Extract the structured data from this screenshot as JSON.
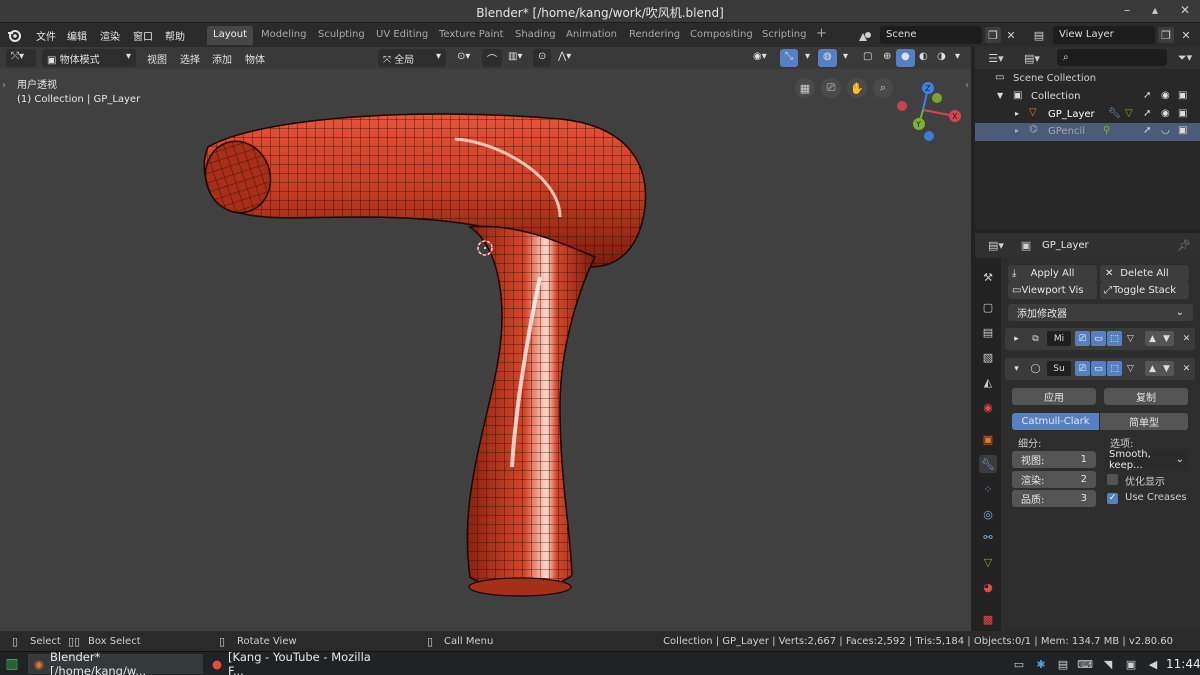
{
  "window": {
    "title": "Blender* [/home/kang/work/吹风机.blend]",
    "minimize": "–",
    "maximize": "▴",
    "close": "✕"
  },
  "menu": [
    "文件",
    "编辑",
    "渲染",
    "窗口",
    "帮助"
  ],
  "workspaces": [
    "Layout",
    "Modeling",
    "Sculpting",
    "UV Editing",
    "Texture Paint",
    "Shading",
    "Animation",
    "Rendering",
    "Compositing",
    "Scripting"
  ],
  "active_workspace": "Layout",
  "add_workspace": "+",
  "scene": {
    "name": "Scene",
    "view_layer": "View Layer"
  },
  "viewport": {
    "mode": "物体模式",
    "menus": [
      "视图",
      "选择",
      "添加",
      "物体"
    ],
    "transform": "全局",
    "view_name": "用户透视",
    "collection_info": "(1) Collection | GP_Layer",
    "gizmo": {
      "x": "X",
      "y": "Y",
      "z": "Z"
    },
    "mesh_color": "#c4391f"
  },
  "outliner": {
    "search_placeholder": "",
    "items": [
      {
        "label": "Scene Collection"
      },
      {
        "label": "Collection"
      },
      {
        "label": "GP_Layer"
      },
      {
        "label": "GPencil"
      }
    ]
  },
  "properties": {
    "object_name": "GP_Layer",
    "apply_all": "Apply All",
    "delete_all": "Delete All",
    "viewport_vis": "Viewport Vis",
    "toggle_stack": "Toggle Stack",
    "add_modifier": "添加修改器",
    "modifiers": [
      {
        "name": "Mi",
        "expanded": false
      },
      {
        "name": "Su",
        "expanded": true
      }
    ],
    "apply": "应用",
    "copy": "复制",
    "catmull": "Catmull-Clark",
    "simple": "简单型",
    "subdiv_label": "细分:",
    "options_label": "选项:",
    "view_label": "视图:",
    "view_value": "1",
    "render_label": "渲染:",
    "render_value": "2",
    "quality_label": "品质:",
    "quality_value": "3",
    "uv_option": "Smooth, keep...",
    "optimal_display": "优化显示",
    "optimal_checked": false,
    "use_creases": "Use Creases",
    "creases_checked": true
  },
  "status": {
    "select": "Select",
    "box_select": "Box Select",
    "rotate": "Rotate View",
    "call_menu": "Call Menu",
    "stats": "Collection | GP_Layer | Verts:2,667 | Faces:2,592 | Tris:5,184 | Objects:0/1 | Mem: 134.7 MB | v2.80.60"
  },
  "taskbar": {
    "items": [
      "Blender* [/home/kang/w...",
      "[Kang - YouTube - Mozilla F..."
    ],
    "clock": "11:44"
  },
  "colors": {
    "accent": "#5680c2",
    "orange": "#e8772e"
  }
}
